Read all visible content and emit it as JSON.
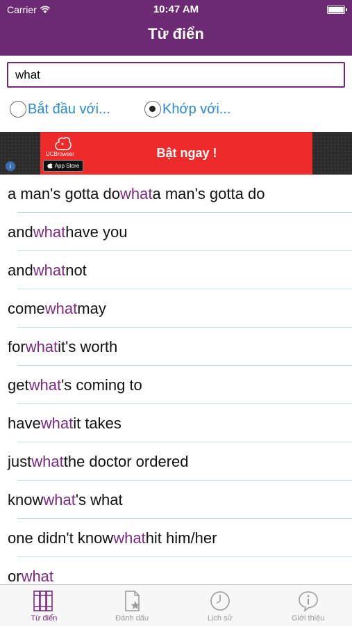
{
  "status_bar": {
    "carrier": "Carrier",
    "time": "10:47 AM"
  },
  "nav": {
    "title": "Từ điển"
  },
  "search": {
    "value": "what"
  },
  "radios": [
    {
      "label": "Bắt đầu với...",
      "checked": false
    },
    {
      "label": "Khớp với...",
      "checked": true
    }
  ],
  "ad": {
    "brand": "UCBrowser",
    "store": "App Store",
    "cta": "Bật ngay !"
  },
  "results": [
    {
      "pre": "a man's gotta do ",
      "hl": "what",
      "post": " a man's gotta do"
    },
    {
      "pre": "and ",
      "hl": "what",
      "post": " have you"
    },
    {
      "pre": "and ",
      "hl": "what",
      "post": "not"
    },
    {
      "pre": "come ",
      "hl": "what",
      "post": " may"
    },
    {
      "pre": "for ",
      "hl": "what",
      "post": " it's worth"
    },
    {
      "pre": "get ",
      "hl": "what",
      "post": "'s coming to"
    },
    {
      "pre": "have ",
      "hl": "what",
      "post": " it takes"
    },
    {
      "pre": "just ",
      "hl": "what",
      "post": " the doctor ordered"
    },
    {
      "pre": "know ",
      "hl": "what",
      "post": "'s what"
    },
    {
      "pre": "one didn't know ",
      "hl": "what",
      "post": " hit him/her"
    },
    {
      "pre": "or ",
      "hl": "what",
      "post": ""
    }
  ],
  "tabs": [
    {
      "label": "Từ điển",
      "icon": "books-icon",
      "active": true
    },
    {
      "label": "Đánh dấu",
      "icon": "bookmark-star-icon",
      "active": false
    },
    {
      "label": "Lịch sử",
      "icon": "clock-icon",
      "active": false
    },
    {
      "label": "Giới thiệu",
      "icon": "info-icon",
      "active": false
    }
  ],
  "colors": {
    "primary": "#6b2a72",
    "highlight": "#7a2a80",
    "link": "#2a8ad4",
    "ad_red": "#ee2b2b"
  }
}
